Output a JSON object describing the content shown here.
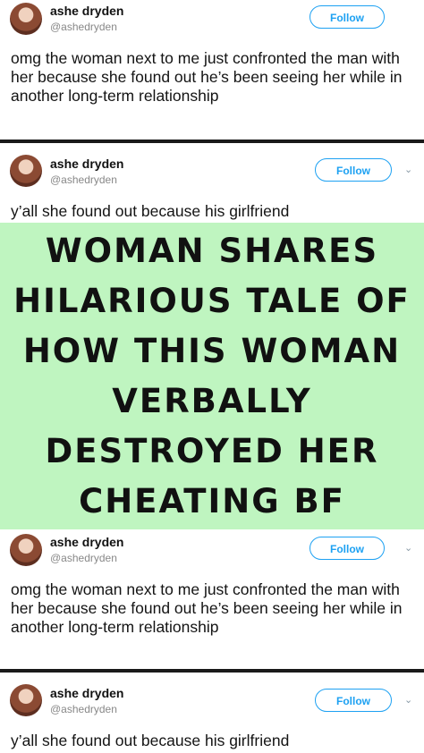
{
  "tweets": [
    {
      "author_name": "ashe dryden",
      "author_handle": "@ashedryden",
      "follow_label": "Follow",
      "text": "omg the woman next to me just confronted the man with her because she found out he’s been seeing her while in another long-term relationship"
    },
    {
      "author_name": "ashe dryden",
      "author_handle": "@ashedryden",
      "follow_label": "Follow",
      "text": "y’all she found out because his girlfriend"
    },
    {
      "author_name": "ashe dryden",
      "author_handle": "@ashedryden",
      "follow_label": "Follow",
      "text": "omg the woman next to me just confronted the man with her because she found out he’s been seeing her while in another long-term relationship"
    },
    {
      "author_name": "ashe dryden",
      "author_handle": "@ashedryden",
      "follow_label": "Follow",
      "text": "y’all she found out because his girlfriend"
    }
  ],
  "banner": {
    "headline": "WOMAN SHARES HILARIOUS TALE OF HOW THIS WOMAN VERBALLY DESTROYED HER CHEATING BF",
    "background_color": "#bff5c0"
  },
  "colors": {
    "follow_blue": "#1da1f2",
    "handle_gray": "#888888"
  },
  "icons": {
    "dropdown": "chevron-down-icon"
  }
}
